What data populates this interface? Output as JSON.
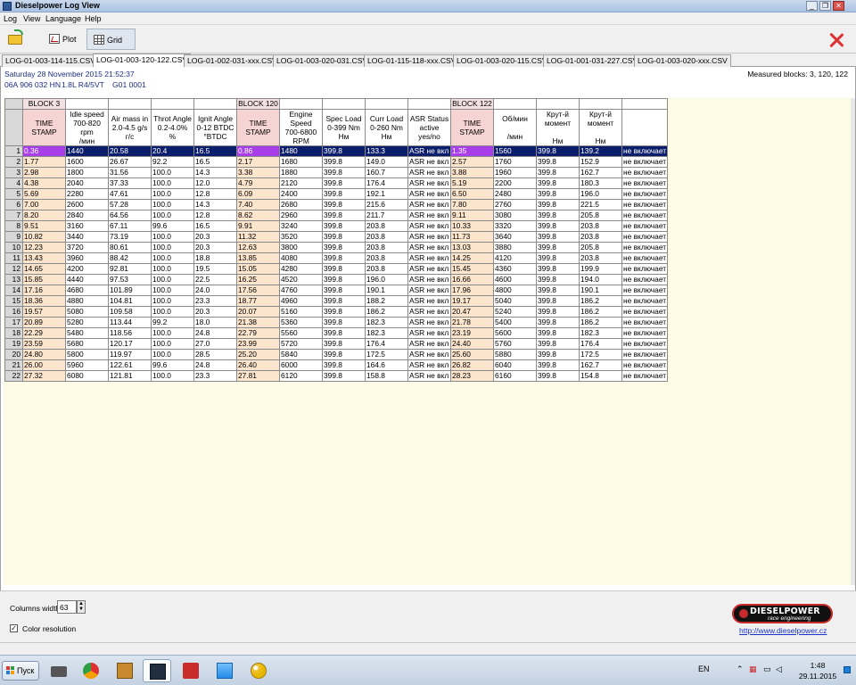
{
  "window": {
    "title": "Dieselpower Log View",
    "controls": {
      "minimize": "_",
      "restore": "❐",
      "close": "✕"
    }
  },
  "menu": [
    "Log",
    "View",
    "Language",
    "Help"
  ],
  "toolbar": {
    "open_icon": "open-folder-icon",
    "plot_label": "Plot",
    "grid_label": "Grid",
    "close_icon": "red-x-icon",
    "accent_close": "#e03131"
  },
  "tabs": [
    "LOG-01-003-114-115.CSV",
    "LOG-01-003-120-122.CSV",
    "LOG-01-002-031-xxx.CSV",
    "LOG-01-003-020-031.CSV",
    "LOG-01-115-118-xxx.CSV",
    "LOG-01-003-020-115.CSV",
    "LOG-01-001-031-227.CSV",
    "LOG-01-003-020-xxx.CSV"
  ],
  "active_tab": 1,
  "info": {
    "date": "Saturday 28 November 2015 21:52:37",
    "part_number": "06A 906 032 HN",
    "engine": "1.8L R4/5VT",
    "code": "G01 0001",
    "measured_blocks": "Measured blocks: 3, 120, 122"
  },
  "grid": {
    "block_row": [
      "",
      "BLOCK 3",
      "",
      "",
      "",
      "",
      "BLOCK 120",
      "",
      "",
      "",
      "",
      "BLOCK 122",
      "",
      "",
      "",
      ""
    ],
    "headers": [
      [
        ""
      ],
      [
        "TIME",
        "STAMP"
      ],
      [
        "Idle speed",
        "700-820 rpm",
        "/мин"
      ],
      [
        "Air mass in",
        "2.0-4.5 g/s",
        "г/с"
      ],
      [
        "Throt Angle",
        "0.2-4.0%",
        "%"
      ],
      [
        "Ignit Angle",
        "0-12 BTDC",
        "°BTDC"
      ],
      [
        "TIME",
        "STAMP"
      ],
      [
        "Engine",
        "Speed",
        "700-6800",
        "RPM"
      ],
      [
        "Spec Load",
        "0-399 Nm",
        "Нм"
      ],
      [
        "Curr Load",
        "0-260 Nm",
        "Нм"
      ],
      [
        "ASR Status",
        "active",
        "yes/no"
      ],
      [
        "TIME",
        "STAMP"
      ],
      [
        "Об/мин",
        "",
        "/мин"
      ],
      [
        "Крут-й",
        "момент",
        "",
        "Нм"
      ],
      [
        "Крут-й",
        "момент",
        "",
        "Нм"
      ],
      [
        ""
      ]
    ],
    "rows": [
      [
        "1",
        "0.36",
        "1440",
        "20.58",
        "20.4",
        "16.5",
        "0.86",
        "1480",
        "399.8",
        "133.3",
        "ASR не вкл",
        "1.35",
        "1560",
        "399.8",
        "139.2",
        "не включает"
      ],
      [
        "2",
        "1.77",
        "1600",
        "26.67",
        "92.2",
        "16.5",
        "2.17",
        "1680",
        "399.8",
        "149.0",
        "ASR не вкл",
        "2.57",
        "1760",
        "399.8",
        "152.9",
        "не включает"
      ],
      [
        "3",
        "2.98",
        "1800",
        "31.56",
        "100.0",
        "14.3",
        "3.38",
        "1880",
        "399.8",
        "160.7",
        "ASR не вкл",
        "3.88",
        "1960",
        "399.8",
        "162.7",
        "не включает"
      ],
      [
        "4",
        "4.38",
        "2040",
        "37.33",
        "100.0",
        "12.0",
        "4.79",
        "2120",
        "399.8",
        "176.4",
        "ASR не вкл",
        "5.19",
        "2200",
        "399.8",
        "180.3",
        "не включает"
      ],
      [
        "5",
        "5.69",
        "2280",
        "47.61",
        "100.0",
        "12.8",
        "6.09",
        "2400",
        "399.8",
        "192.1",
        "ASR не вкл",
        "6.50",
        "2480",
        "399.8",
        "196.0",
        "не включает"
      ],
      [
        "6",
        "7.00",
        "2600",
        "57.28",
        "100.0",
        "14.3",
        "7.40",
        "2680",
        "399.8",
        "215.6",
        "ASR не вкл",
        "7.80",
        "2760",
        "399.8",
        "221.5",
        "не включает"
      ],
      [
        "7",
        "8.20",
        "2840",
        "64.56",
        "100.0",
        "12.8",
        "8.62",
        "2960",
        "399.8",
        "211.7",
        "ASR не вкл",
        "9.11",
        "3080",
        "399.8",
        "205.8",
        "не включает"
      ],
      [
        "8",
        "9.51",
        "3160",
        "67.11",
        "99.6",
        "16.5",
        "9.91",
        "3240",
        "399.8",
        "203.8",
        "ASR не вкл",
        "10.33",
        "3320",
        "399.8",
        "203.8",
        "не включает"
      ],
      [
        "9",
        "10.82",
        "3440",
        "73.19",
        "100.0",
        "20.3",
        "11.32",
        "3520",
        "399.8",
        "203.8",
        "ASR не вкл",
        "11.73",
        "3640",
        "399.8",
        "203.8",
        "не включает"
      ],
      [
        "10",
        "12.23",
        "3720",
        "80.61",
        "100.0",
        "20.3",
        "12.63",
        "3800",
        "399.8",
        "203.8",
        "ASR не вкл",
        "13.03",
        "3880",
        "399.8",
        "205.8",
        "не включает"
      ],
      [
        "11",
        "13.43",
        "3960",
        "88.42",
        "100.0",
        "18.8",
        "13.85",
        "4080",
        "399.8",
        "203.8",
        "ASR не вкл",
        "14.25",
        "4120",
        "399.8",
        "203.8",
        "не включает"
      ],
      [
        "12",
        "14.65",
        "4200",
        "92.81",
        "100.0",
        "19.5",
        "15.05",
        "4280",
        "399.8",
        "203.8",
        "ASR не вкл",
        "15.45",
        "4360",
        "399.8",
        "199.9",
        "не включает"
      ],
      [
        "13",
        "15.85",
        "4440",
        "97.53",
        "100.0",
        "22.5",
        "16.25",
        "4520",
        "399.8",
        "196.0",
        "ASR не вкл",
        "16.66",
        "4600",
        "399.8",
        "194.0",
        "не включает"
      ],
      [
        "14",
        "17.16",
        "4680",
        "101.89",
        "100.0",
        "24.0",
        "17.56",
        "4760",
        "399.8",
        "190.1",
        "ASR не вкл",
        "17.96",
        "4800",
        "399.8",
        "190.1",
        "не включает"
      ],
      [
        "15",
        "18.36",
        "4880",
        "104.81",
        "100.0",
        "23.3",
        "18.77",
        "4960",
        "399.8",
        "188.2",
        "ASR не вкл",
        "19.17",
        "5040",
        "399.8",
        "186.2",
        "не включает"
      ],
      [
        "16",
        "19.57",
        "5080",
        "109.58",
        "100.0",
        "20.3",
        "20.07",
        "5160",
        "399.8",
        "186.2",
        "ASR не вкл",
        "20.47",
        "5240",
        "399.8",
        "186.2",
        "не включает"
      ],
      [
        "17",
        "20.89",
        "5280",
        "113.44",
        "99.2",
        "18.0",
        "21.38",
        "5360",
        "399.8",
        "182.3",
        "ASR не вкл",
        "21.78",
        "5400",
        "399.8",
        "186.2",
        "не включает"
      ],
      [
        "18",
        "22.29",
        "5480",
        "118.56",
        "100.0",
        "24.8",
        "22.79",
        "5560",
        "399.8",
        "182.3",
        "ASR не вкл",
        "23.19",
        "5600",
        "399.8",
        "182.3",
        "не включает"
      ],
      [
        "19",
        "23.59",
        "5680",
        "120.17",
        "100.0",
        "27.0",
        "23.99",
        "5720",
        "399.8",
        "176.4",
        "ASR не вкл",
        "24.40",
        "5760",
        "399.8",
        "176.4",
        "не включает"
      ],
      [
        "20",
        "24.80",
        "5800",
        "119.97",
        "100.0",
        "28.5",
        "25.20",
        "5840",
        "399.8",
        "172.5",
        "ASR не вкл",
        "25.60",
        "5880",
        "399.8",
        "172.5",
        "не включает"
      ],
      [
        "21",
        "26.00",
        "5960",
        "122.61",
        "99.6",
        "24.8",
        "26.40",
        "6000",
        "399.8",
        "164.6",
        "ASR не вкл",
        "26.82",
        "6040",
        "399.8",
        "162.7",
        "не включает"
      ],
      [
        "22",
        "27.32",
        "6080",
        "121.81",
        "100.0",
        "23.3",
        "27.81",
        "6120",
        "399.8",
        "158.8",
        "ASR не вкл",
        "28.23",
        "6160",
        "399.8",
        "154.8",
        "не включает"
      ]
    ],
    "selected_row": 0,
    "colors": {
      "timestamp_bg": "#fce5cd",
      "selected_bg": "#0b1e6b",
      "selected_ts_bg": "#a83ee8",
      "grid_area_bg": "#fdfbe6"
    }
  },
  "footer": {
    "columns_width_label": "Columns width:",
    "columns_width_value": "63",
    "color_resolution_label": "Color resolution",
    "color_resolution_checked": "✓",
    "logo_name": "DIESELPOWER",
    "logo_sub": "race engineering",
    "url": "http://www.dieselpower.cz"
  },
  "taskbar": {
    "start_label": "Пуск",
    "apps": [
      "printer-icon",
      "chrome-icon",
      "package-icon",
      "logview-icon",
      "pdf-icon",
      "image-viewer-icon",
      "paint-icon"
    ],
    "lang": "EN",
    "time": "1:48",
    "date": "29.11.2015"
  }
}
